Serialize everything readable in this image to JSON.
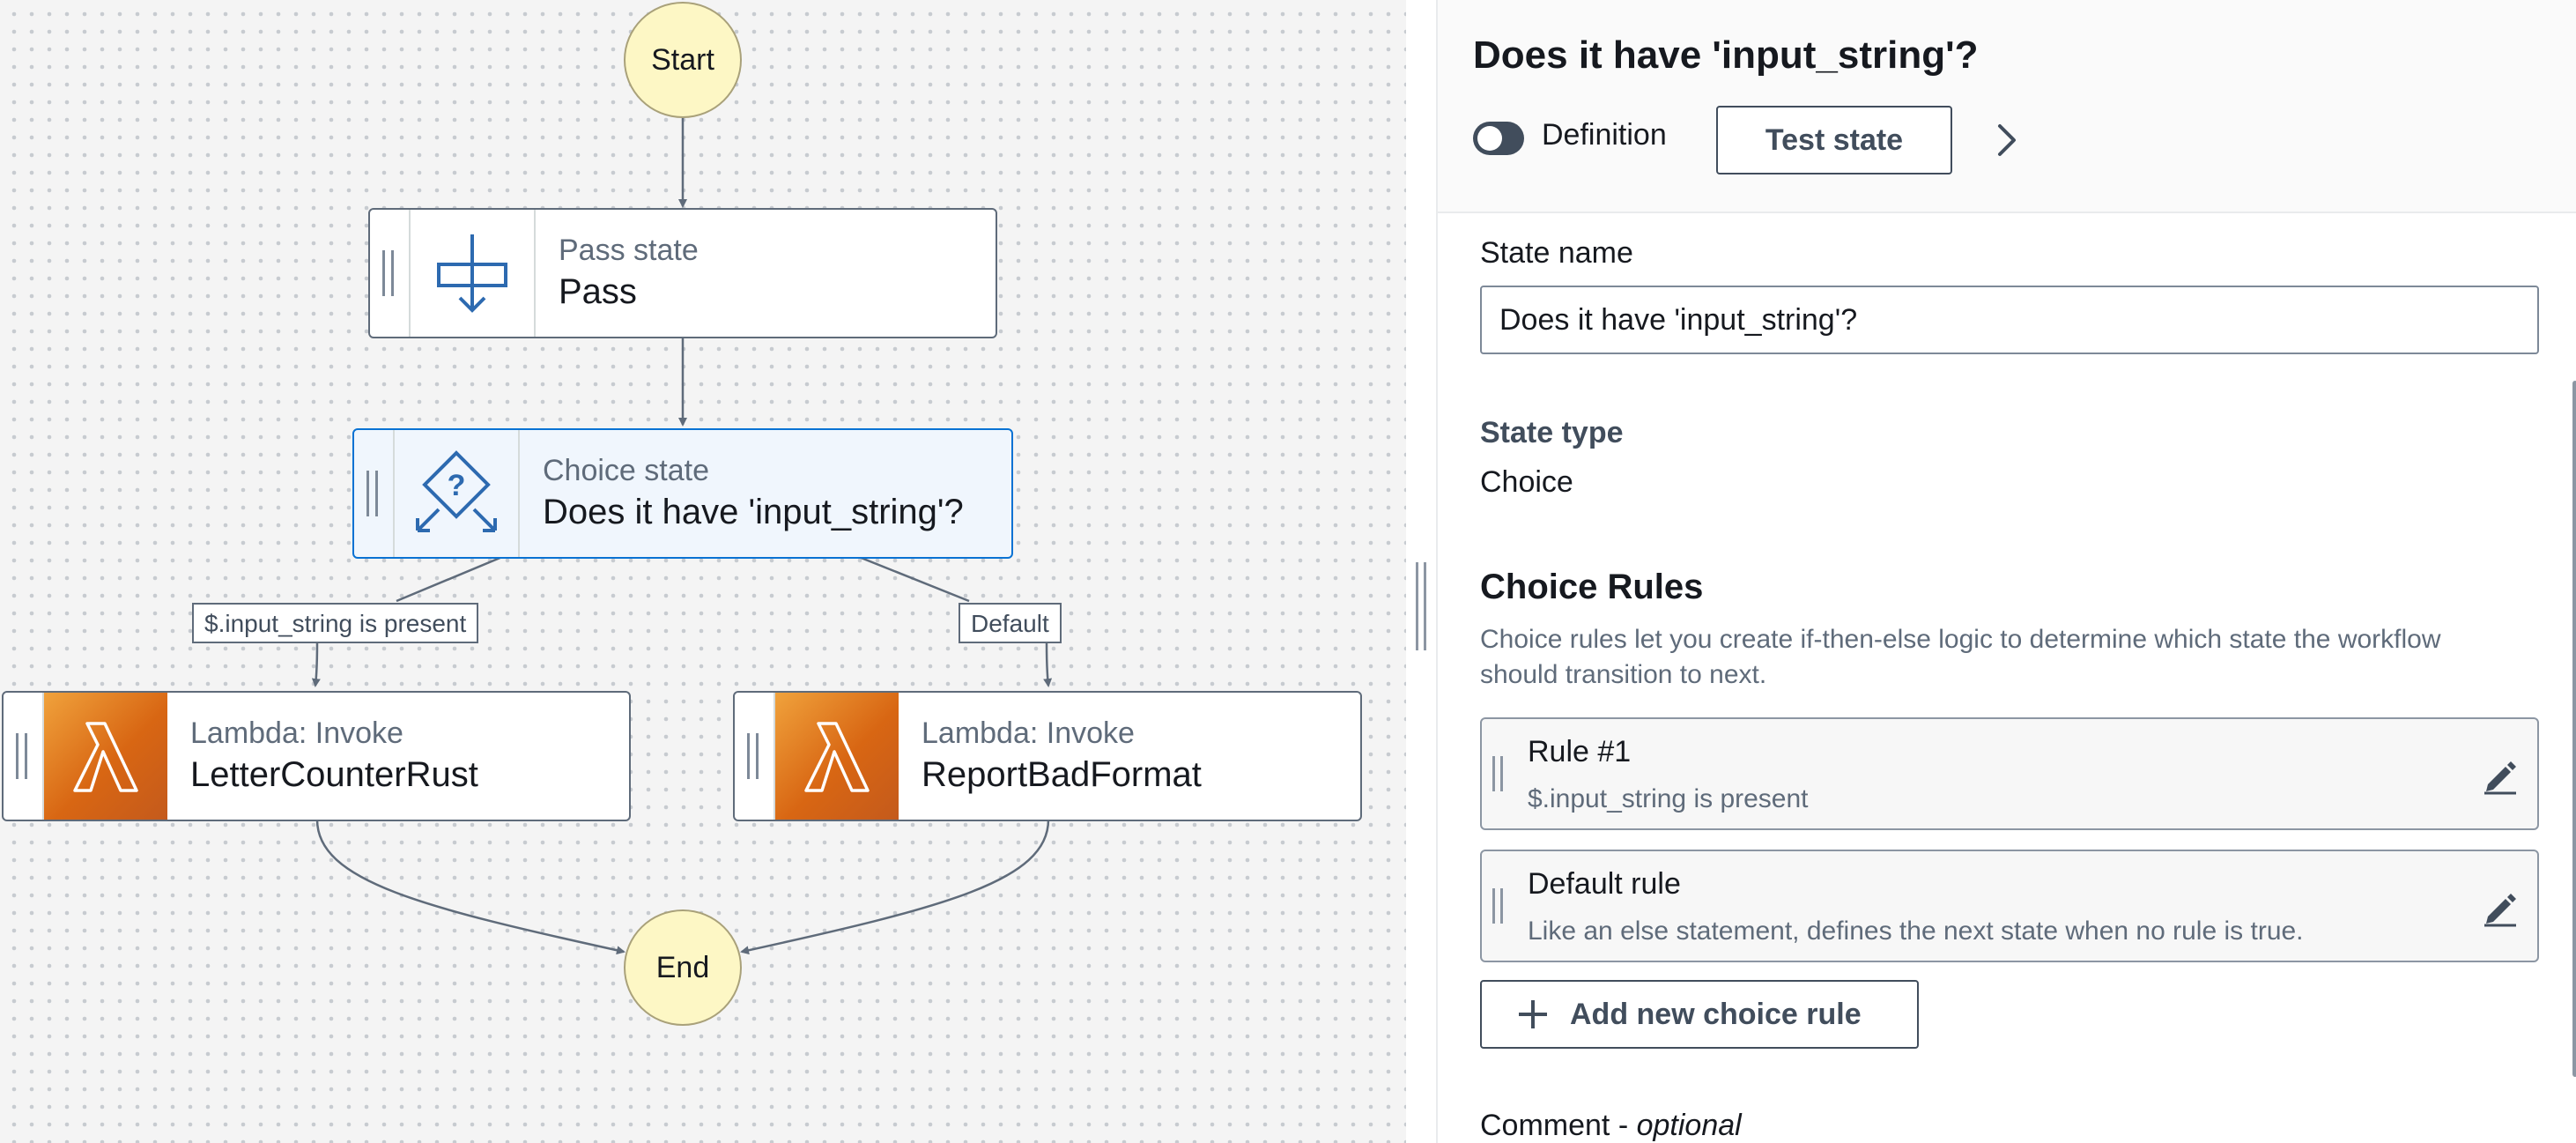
{
  "canvas": {
    "start_label": "Start",
    "end_label": "End",
    "nodes": {
      "pass": {
        "type_label": "Pass state",
        "name": "Pass"
      },
      "choice": {
        "type_label": "Choice state",
        "name": "Does it have 'input_string'?"
      },
      "lambda_left": {
        "type_label": "Lambda: Invoke",
        "name": "LetterCounterRust"
      },
      "lambda_right": {
        "type_label": "Lambda: Invoke",
        "name": "ReportBadFormat"
      }
    },
    "edge_labels": {
      "left": "$.input_string is present",
      "right": "Default"
    }
  },
  "panel": {
    "title": "Does it have 'input_string'?",
    "definition_toggle_label": "Definition",
    "definition_toggle_on": false,
    "test_state_label": "Test state",
    "state_name_label": "State name",
    "state_name_value": "Does it have 'input_string'?",
    "state_type_label": "State type",
    "state_type_value": "Choice",
    "choice_rules_heading": "Choice Rules",
    "choice_rules_description": "Choice rules let you create if-then-else logic to determine which state the workflow should transition to next.",
    "rules": [
      {
        "title": "Rule #1",
        "condition": "$.input_string is present"
      },
      {
        "title": "Default rule",
        "condition": "Like an else statement, defines the next state when no rule is true."
      }
    ],
    "add_rule_label": "Add new choice rule",
    "comment_label": "Comment - ",
    "comment_optional": "optional"
  },
  "colors": {
    "accent": "#0972d3",
    "lambda_orange": "#d86613",
    "start_end_fill": "#fdf7c5",
    "canvas_bg": "#f4f4f4"
  }
}
